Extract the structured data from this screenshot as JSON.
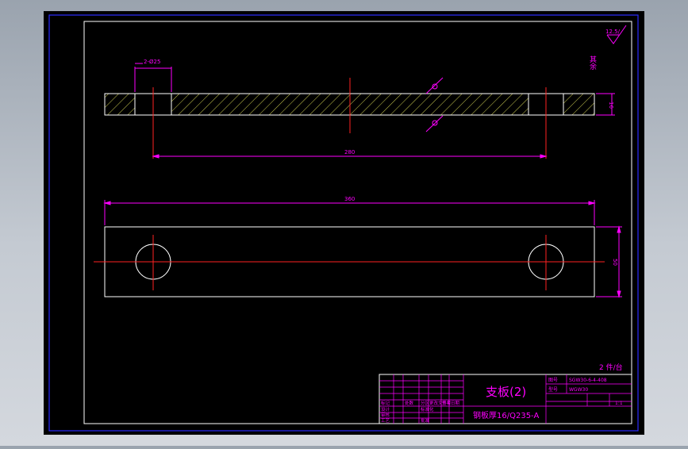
{
  "drawing": {
    "roughness": "12.5/",
    "roughness_note": "其余",
    "hole_spec": "2-Ø25",
    "thickness_dim": "16",
    "center_distance_dim": "280",
    "overall_length_dim": "360",
    "width_dim": "50",
    "quantity_note": "2 件/台"
  },
  "title_block": {
    "part_name": "支板(2)",
    "material": "钢板厚16/Q235-A",
    "drawing_no_label": "图号",
    "drawing_no": "SGW30-6-4-408",
    "model_label": "型号",
    "model": "WGW30",
    "scale": "1:1",
    "rev_table": [
      [
        "标记",
        "处数",
        "分区",
        "更改文件号",
        "签名",
        "日期"
      ],
      [
        "设计",
        "",
        "标准化",
        "",
        "",
        ""
      ],
      [
        "审核",
        "",
        "",
        "",
        "",
        ""
      ],
      [
        "工艺",
        "",
        "批准",
        "",
        "",
        ""
      ]
    ]
  },
  "colors": {
    "screen_background": "#a9b0b9",
    "paper": "#000000",
    "border": "#0000ff",
    "outline": "#ffffff",
    "hatch": "#ffff66",
    "centerline": "#ff2222",
    "dimension": "#ff00ff"
  }
}
